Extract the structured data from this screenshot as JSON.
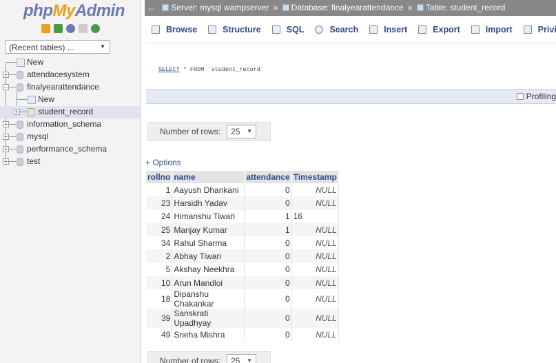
{
  "logo": {
    "php": "php",
    "my": "My",
    "admin": "Admin"
  },
  "quicklinks": [
    "home-icon",
    "exit-icon",
    "query-icon",
    "docs-icon",
    "reload-icon"
  ],
  "recent_tables": "(Recent tables) ...",
  "tree": {
    "new": "New",
    "dbs": [
      "attendacesystem",
      "finalyearattendance",
      "information_schema",
      "mysql",
      "performance_schema",
      "test"
    ],
    "child_new": "New",
    "child_table": "student_record"
  },
  "breadcrumb": {
    "server": "Server: mysql wampserver",
    "database": "Database: finalyearattendance",
    "table": "Table: student_record",
    "sep": "»"
  },
  "tabs": [
    "Browse",
    "Structure",
    "SQL",
    "Search",
    "Insert",
    "Export",
    "Import",
    "Privileges"
  ],
  "sql": {
    "kw": "SELECT",
    "rest": " * FROM `student_record`"
  },
  "profiling": "Profiling",
  "rows_label": "Number of rows:",
  "rows_value": "25",
  "options": "+ Options",
  "columns": [
    "rollno",
    "name",
    "attendance",
    "Timestamp"
  ],
  "rows": [
    [
      "1",
      "Aayush Dhankani",
      "0",
      "NULL"
    ],
    [
      "23",
      "Harsidh Yadav",
      "0",
      "NULL"
    ],
    [
      "24",
      "Himanshu Tiwari",
      "1",
      "16"
    ],
    [
      "25",
      "Manjay Kumar",
      "1",
      "NULL"
    ],
    [
      "34",
      "Rahul Sharma",
      "0",
      "NULL"
    ],
    [
      "2",
      "Abhay Tiwari",
      "0",
      "NULL"
    ],
    [
      "5",
      "Akshay Neekhra",
      "0",
      "NULL"
    ],
    [
      "10",
      "Arun Mandloi",
      "0",
      "NULL"
    ],
    [
      "18",
      "Dipanshu Chakankar",
      "0",
      "NULL"
    ],
    [
      "39",
      "Sanskrati Upadhyay",
      "0",
      "NULL"
    ],
    [
      "49",
      "Sneha Mishra",
      "0",
      "NULL"
    ]
  ],
  "colors": {
    "link": "#2f4a8a",
    "topbar": "#888888",
    "accent_orange": "#f89c0e"
  }
}
